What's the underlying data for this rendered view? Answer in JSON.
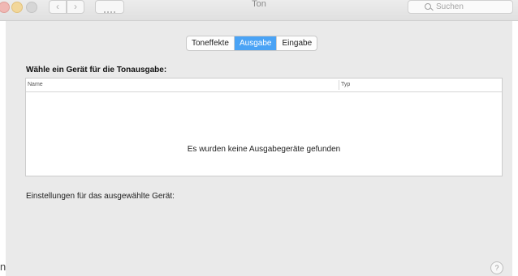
{
  "window": {
    "title": "Ton"
  },
  "toolbar": {
    "back_glyph": "‹",
    "forward_glyph": "›",
    "search_placeholder": "Suchen"
  },
  "tabs": [
    {
      "label": "Toneffekte",
      "active": false
    },
    {
      "label": "Ausgabe",
      "active": true
    },
    {
      "label": "Eingabe",
      "active": false
    }
  ],
  "output": {
    "heading": "Wähle ein Gerät für die Tonausgabe:",
    "columns": {
      "name": "Name",
      "type": "Typ"
    },
    "empty_message": "Es wurden keine Ausgabegeräte gefunden"
  },
  "settings_label": "Einstellungen für das ausgewählte Gerät:",
  "help_glyph": "?",
  "edge_fragment": "n",
  "colors": {
    "accent": "#4aa3f5",
    "panel_background": "#eaeaea"
  },
  "icons": {
    "close": "close-icon",
    "minimize": "minimize-icon",
    "zoom": "zoom-icon",
    "back": "chevron-left-icon",
    "forward": "chevron-right-icon",
    "show_all": "grid-icon",
    "search": "search-icon",
    "help": "help-icon"
  }
}
